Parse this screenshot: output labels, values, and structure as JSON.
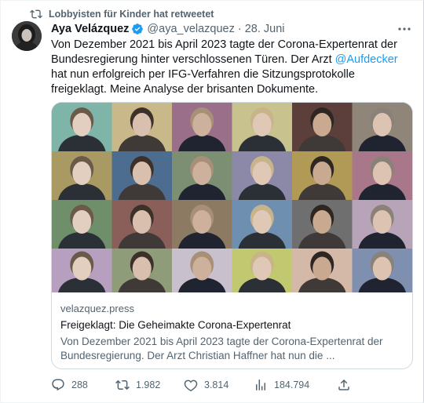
{
  "retweet": {
    "label": "Lobbyisten für Kinder hat retweetet",
    "icon": "retweet-icon"
  },
  "author": {
    "name": "Aya Velázquez",
    "handle": "@aya_velazquez",
    "separator": "·",
    "date": "28. Juni",
    "verified": true
  },
  "tweet": {
    "text_before": "Von Dezember 2021 bis April 2023 tagte der Corona-Expertenrat der Bundesregierung hinter verschlossenen Türen. Der Arzt ",
    "mention": "@Aufdecker",
    "text_after": " hat nun erfolgreich per IFG-Verfahren die Sitzungsprotokolle freigeklagt. Meine Analyse der brisanten Dokumente."
  },
  "card": {
    "domain": "velazquez.press",
    "title": "Freigeklagt: Die Geheimakte Corona-Expertenrat",
    "description": "Von Dezember 2021 bis April 2023 tagte der Corona-Expertenrat der Bundesregierung. Der Arzt Christian Haffner hat nun die ...",
    "image_tiles": 24
  },
  "actions": {
    "replies": "288",
    "retweets": "1.982",
    "likes": "3.814",
    "views": "184.794"
  },
  "colors": {
    "accent": "#1d9bf0",
    "secondary_text": "#536471",
    "primary_text": "#0f1419"
  }
}
